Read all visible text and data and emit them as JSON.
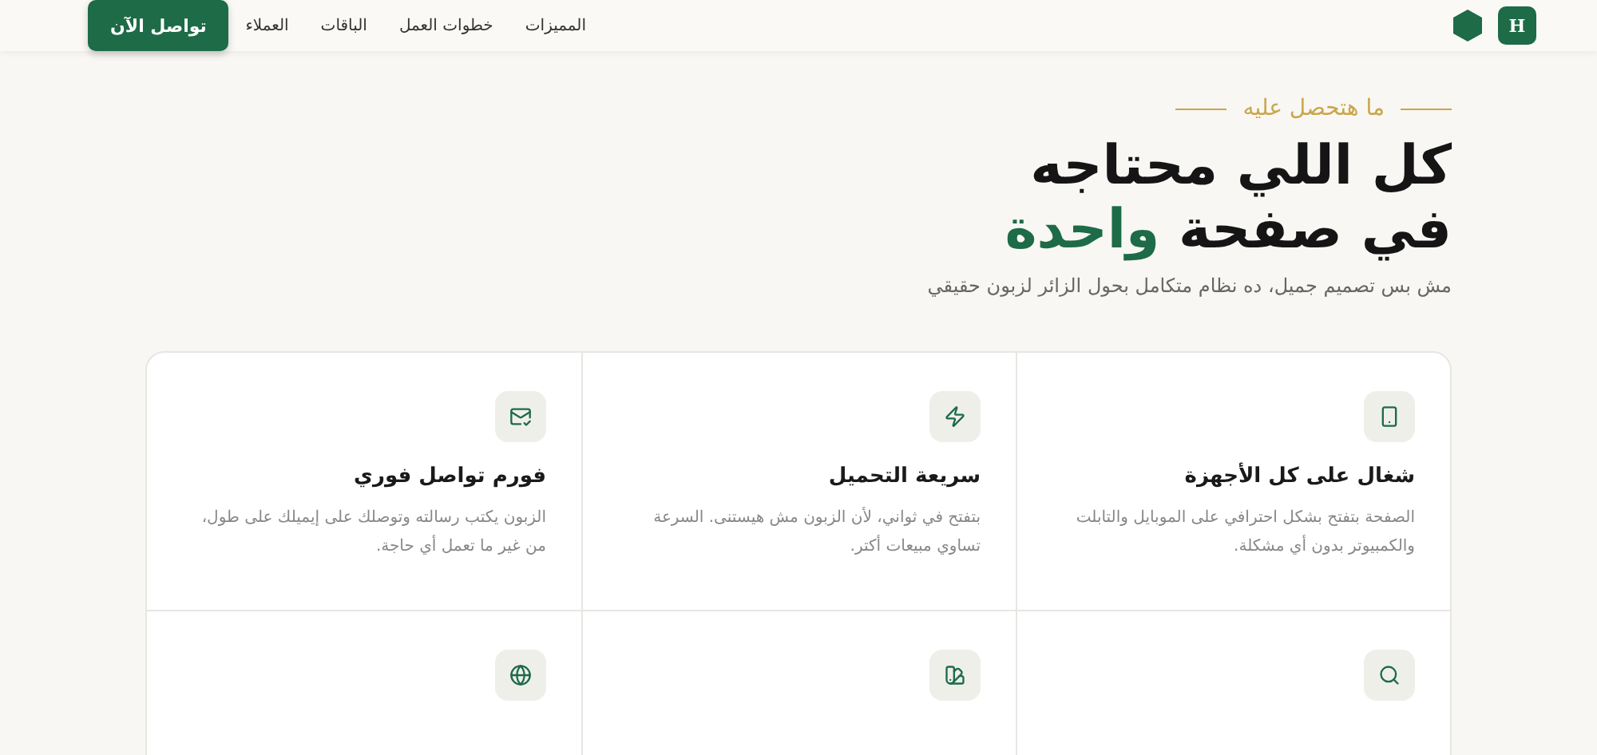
{
  "header": {
    "logo": {
      "letter": "H"
    },
    "nav": [
      {
        "label": "المميزات"
      },
      {
        "label": "خطوات العمل"
      },
      {
        "label": "الباقات"
      },
      {
        "label": "العملاء"
      }
    ],
    "cta": "تواصل الآن"
  },
  "hero": {
    "eyebrow": "ما هتحصل عليه",
    "title_line1": "كل اللي محتاجه",
    "title_line2": "في صفحة",
    "title_highlight": "واحدة",
    "subtitle": "مش بس تصميم جميل، ده نظام متكامل بحول الزائر لزبون حقيقي"
  },
  "features": [
    {
      "kind": "text",
      "title": "شغال على كل الأجهزة",
      "description": "الصفحة بتفتح بشكل احترافي على الموبايل والتابلت والكمبيوتر بدون أي مشكلة."
    },
    {
      "kind": "text",
      "title": "سريعة التحميل",
      "description": "بتفتح في ثواني، لأن الزبون مش هيستنى. السرعة تساوي مبيعات أكتر."
    },
    {
      "kind": "text",
      "title": "فورم تواصل فوري",
      "description": "الزبون يكتب رسالته وتوصلك على إيميلك على طول، من غير ما تعمل أي حاجة."
    },
    {
      "kind": "icon"
    },
    {
      "kind": "icon"
    },
    {
      "kind": "icon"
    }
  ]
}
